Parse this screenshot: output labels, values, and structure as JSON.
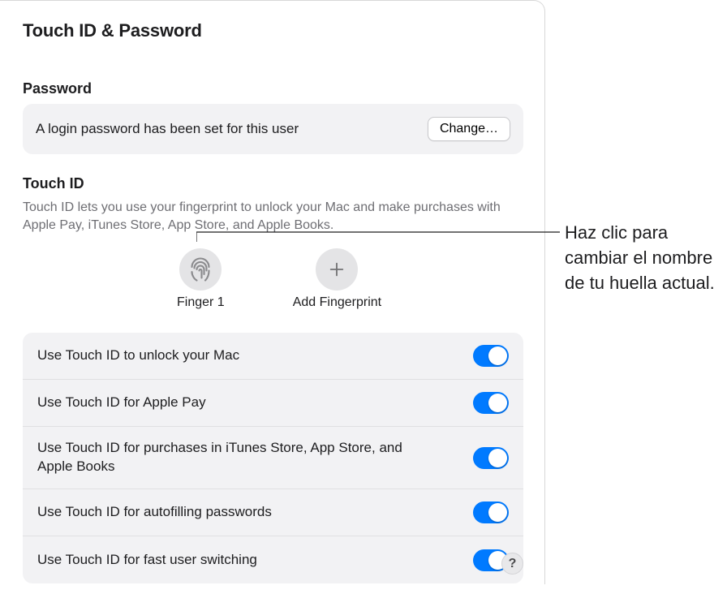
{
  "page_title": "Touch ID & Password",
  "password": {
    "heading": "Password",
    "description": "A login password has been set for this user",
    "change_label": "Change…"
  },
  "touchid": {
    "heading": "Touch ID",
    "description": "Touch ID lets you use your fingerprint to unlock your Mac and make purchases with Apple Pay, iTunes Store, App Store, and Apple Books.",
    "fingerprints": [
      {
        "label": "Finger 1",
        "icon": "fingerprint-icon"
      },
      {
        "label": "Add Fingerprint",
        "icon": "plus-icon"
      }
    ],
    "options": [
      {
        "label": "Use Touch ID to unlock your Mac",
        "enabled": true
      },
      {
        "label": "Use Touch ID for Apple Pay",
        "enabled": true
      },
      {
        "label": "Use Touch ID for purchases in iTunes Store, App Store, and Apple Books",
        "enabled": true
      },
      {
        "label": "Use Touch ID for autofilling passwords",
        "enabled": true
      },
      {
        "label": "Use Touch ID for fast user switching",
        "enabled": true
      }
    ]
  },
  "help_label": "?",
  "callout_text": "Haz clic para cambiar el nombre de tu huella actual."
}
